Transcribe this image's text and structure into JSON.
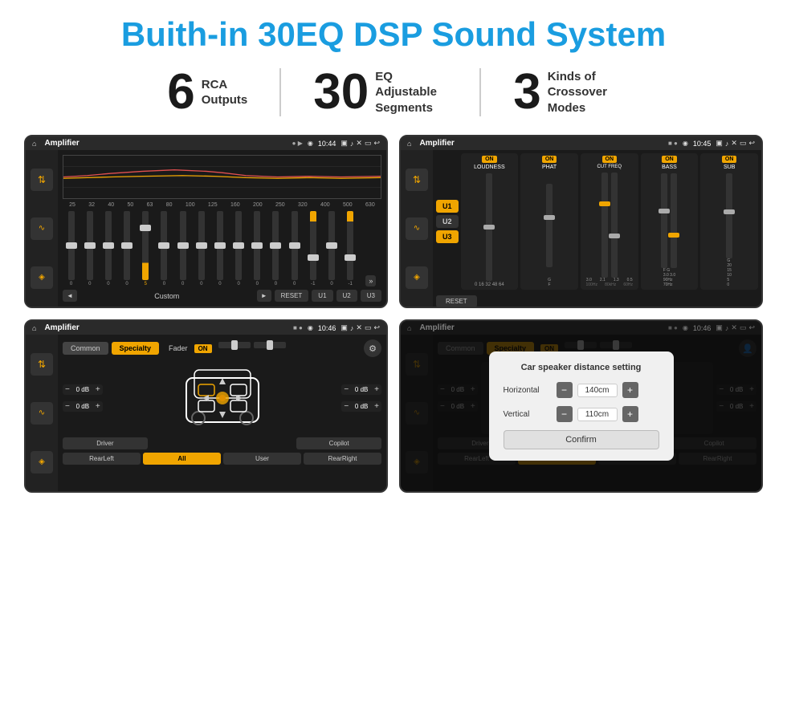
{
  "header": {
    "title": "Buith-in 30EQ DSP Sound System"
  },
  "stats": [
    {
      "number": "6",
      "label": "RCA\nOutputs"
    },
    {
      "number": "30",
      "label": "EQ Adjustable\nSegments"
    },
    {
      "number": "3",
      "label": "Kinds of\nCrossover Modes"
    }
  ],
  "screens": [
    {
      "id": "screen1",
      "status_bar": {
        "title": "Amplifier",
        "time": "10:44"
      },
      "type": "eq"
    },
    {
      "id": "screen2",
      "status_bar": {
        "title": "Amplifier",
        "time": "10:45"
      },
      "type": "crossover"
    },
    {
      "id": "screen3",
      "status_bar": {
        "title": "Amplifier",
        "time": "10:46"
      },
      "type": "specialty"
    },
    {
      "id": "screen4",
      "status_bar": {
        "title": "Amplifier",
        "time": "10:46"
      },
      "type": "specialty_dialog"
    }
  ],
  "eq": {
    "frequencies": [
      "25",
      "32",
      "40",
      "50",
      "63",
      "80",
      "100",
      "125",
      "160",
      "200",
      "250",
      "320",
      "400",
      "500",
      "630"
    ],
    "values": [
      "0",
      "0",
      "0",
      "0",
      "5",
      "0",
      "0",
      "0",
      "0",
      "0",
      "0",
      "0",
      "0",
      "-1",
      "0",
      "-1"
    ],
    "thumb_positions": [
      50,
      50,
      50,
      50,
      25,
      50,
      50,
      50,
      50,
      50,
      50,
      50,
      50,
      65,
      50,
      65
    ],
    "preset": "Custom",
    "buttons": [
      "RESET",
      "U1",
      "U2",
      "U3"
    ]
  },
  "crossover": {
    "u_buttons": [
      "U1",
      "U2",
      "U3"
    ],
    "channels": [
      {
        "name": "LOUDNESS",
        "on": true,
        "values": [
          "0",
          "16",
          "32",
          "48",
          "64"
        ]
      },
      {
        "name": "PHAT",
        "on": true
      },
      {
        "name": "CUT FREQ",
        "on": true
      },
      {
        "name": "BASS",
        "on": true
      },
      {
        "name": "SUB",
        "on": true
      }
    ],
    "reset": "RESET"
  },
  "specialty": {
    "tabs": [
      "Common",
      "Specialty"
    ],
    "fader_label": "Fader",
    "fader_on": "ON",
    "speaker_groups": [
      {
        "id": "front-left",
        "db": "0 dB"
      },
      {
        "id": "front-right",
        "db": "0 dB"
      },
      {
        "id": "rear-left",
        "db": "0 dB"
      },
      {
        "id": "rear-right",
        "db": "0 dB"
      }
    ],
    "bottom_buttons": [
      "Driver",
      "",
      "Copilot",
      "RearLeft",
      "All",
      "User",
      "RearRight"
    ]
  },
  "dialog": {
    "title": "Car speaker distance setting",
    "horizontal_label": "Horizontal",
    "horizontal_value": "140cm",
    "vertical_label": "Vertical",
    "vertical_value": "110cm",
    "confirm_label": "Confirm"
  },
  "icons": {
    "home": "⌂",
    "location": "◉",
    "camera": "📷",
    "volume": "🔊",
    "back": "↩",
    "eq_icon": "≡",
    "wave_icon": "〜",
    "speaker_icon": "◈",
    "chevron_down": "▼",
    "chevron_up": "▲",
    "chevron_left": "◄",
    "chevron_right": "►",
    "settings": "⚙",
    "person": "👤"
  }
}
